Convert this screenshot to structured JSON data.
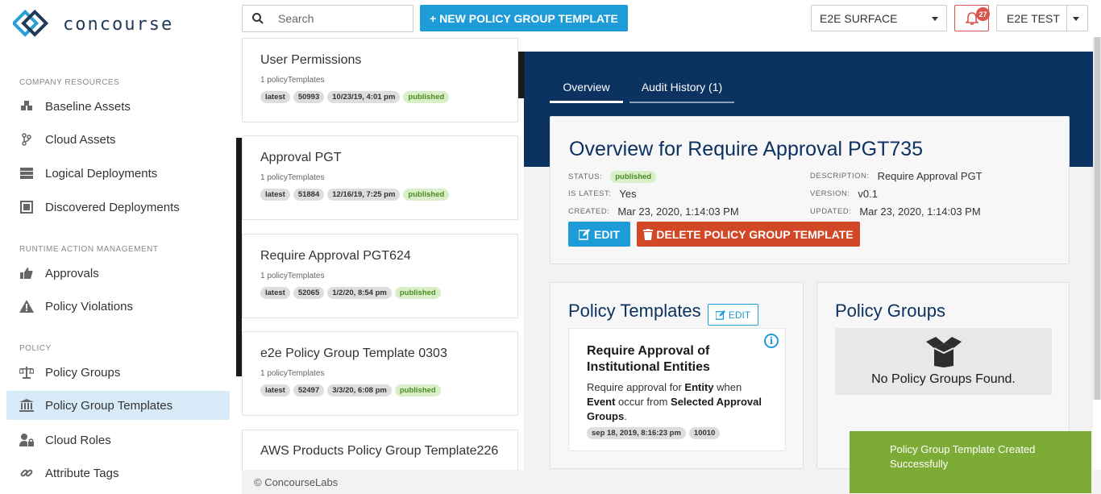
{
  "app": {
    "logo_text": "concourse"
  },
  "sidebar": {
    "sections": [
      {
        "title": "COMPANY RESOURCES"
      },
      {
        "title": "RUNTIME ACTION MANAGEMENT"
      },
      {
        "title": "POLICY"
      }
    ],
    "items": [
      {
        "label": "Baseline Assets",
        "icon": "cubes-icon"
      },
      {
        "label": "Cloud Assets",
        "icon": "branch-icon"
      },
      {
        "label": "Logical Deployments",
        "icon": "server-icon"
      },
      {
        "label": "Discovered Deployments",
        "icon": "scan-icon"
      },
      {
        "label": "Approvals",
        "icon": "thumbs-up-icon"
      },
      {
        "label": "Policy Violations",
        "icon": "warning-icon"
      },
      {
        "label": "Policy Groups",
        "icon": "balance-scale-icon"
      },
      {
        "label": "Policy Group Templates",
        "icon": "institution-icon",
        "active": true
      },
      {
        "label": "Cloud Roles",
        "icon": "user-lock-icon"
      },
      {
        "label": "Attribute Tags",
        "icon": "link-icon"
      }
    ]
  },
  "topbar": {
    "search_placeholder": "Search",
    "new_button": "+ NEW POLICY GROUP TEMPLATE",
    "environment": "E2E SURFACE",
    "notification_count": "27",
    "user": "E2E TEST"
  },
  "list": {
    "cards": [
      {
        "title": "User Permissions",
        "sub": "1 policyTemplates",
        "chips": [
          "latest",
          "50993",
          "10/23/19, 4:01 pm"
        ],
        "status": "published"
      },
      {
        "title": "Approval PGT",
        "sub": "1 policyTemplates",
        "chips": [
          "latest",
          "51884",
          "12/16/19, 7:25 pm"
        ],
        "status": "published"
      },
      {
        "title": "Require Approval PGT624",
        "sub": "1 policyTemplates",
        "chips": [
          "latest",
          "52065",
          "1/2/20, 8:54 pm"
        ],
        "status": "published"
      },
      {
        "title": "e2e Policy Group Template 0303",
        "sub": "1 policyTemplates",
        "chips": [
          "latest",
          "52497",
          "3/3/20, 6:08 pm"
        ],
        "status": "published"
      },
      {
        "title": "AWS Products Policy Group Template226",
        "sub": "",
        "chips": [],
        "status": ""
      }
    ]
  },
  "detail": {
    "tabs": {
      "overview": "Overview",
      "audit": "Audit History (1)"
    },
    "title": "Overview for Require Approval PGT735",
    "status_label": "STATUS:",
    "status": "published",
    "is_latest_label": "IS LATEST:",
    "is_latest": "Yes",
    "created_label": "CREATED:",
    "created": "Mar 23, 2020, 1:14:03 PM",
    "description_label": "DESCRIPTION:",
    "description": "Require Approval PGT",
    "version_label": "VERSION:",
    "version": "v0.1",
    "updated_label": "UPDATED:",
    "updated": "Mar 23, 2020, 1:14:03 PM",
    "edit_button": "EDIT",
    "delete_button": "DELETE POLICY GROUP TEMPLATE"
  },
  "policy_templates": {
    "heading": "Policy Templates",
    "edit_button": "EDIT",
    "template": {
      "title": "Require Approval of Institutional Entities",
      "body_1": "Require approval for ",
      "body_entity": "Entity",
      "body_2": " when ",
      "body_event": "Event",
      "body_3": " occur from ",
      "body_groups": "Selected Approval Groups",
      "body_4": ".",
      "date": "sep 18, 2019, 8:16:23 pm",
      "id": "10010"
    }
  },
  "policy_groups": {
    "heading": "Policy Groups",
    "empty_text": "No Policy Groups Found."
  },
  "footer": {
    "text": "© ConcourseLabs"
  },
  "toast": {
    "text": "Policy Group Template Created Successfully"
  },
  "colors": {
    "accent": "#1e9cd7",
    "navy": "#0b3261",
    "danger": "#d24726",
    "success": "#7cac35"
  }
}
